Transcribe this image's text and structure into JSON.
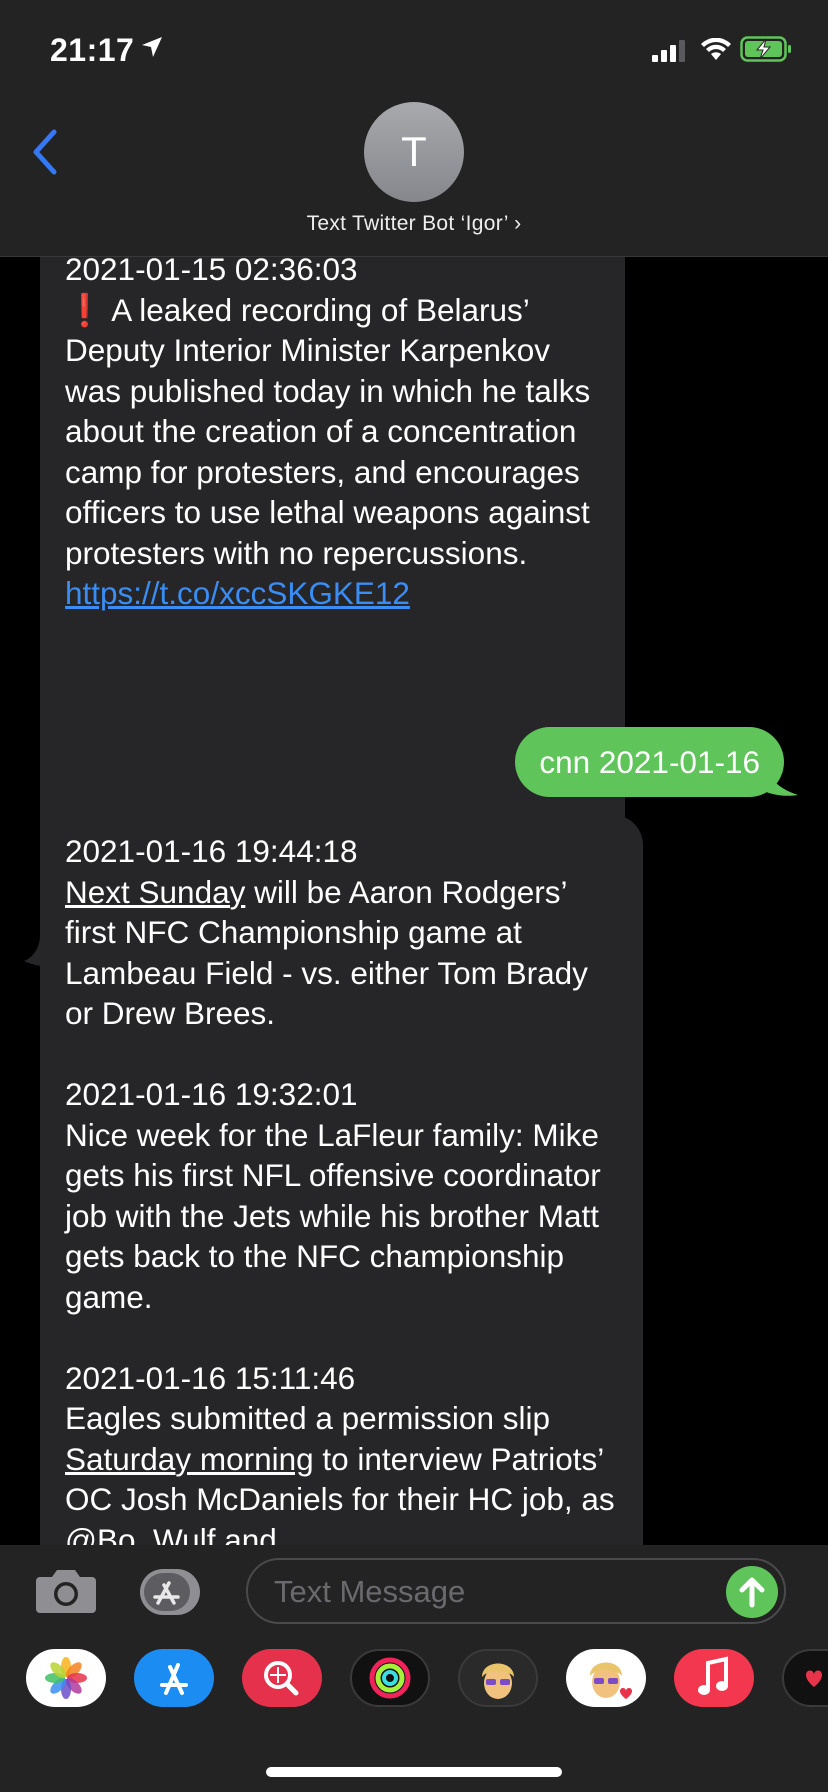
{
  "status_bar": {
    "time": "21:17"
  },
  "header": {
    "avatar_initial": "T",
    "contact_name": "Text Twitter Bot ‘Igor’ ›"
  },
  "messages": {
    "m1": {
      "timestamp": "2021-01-15 02:36:03",
      "emoji": "❗",
      "text": " A leaked recording of Belarus’ Deputy Interior Minister Karpenkov was published today in which he talks about the creation of a concentration camp for protesters, and encourages officers to use lethal weapons against protesters with no repercussions.  ",
      "link": "https://t.co/xccSKGKE12"
    },
    "m2": {
      "text": "cnn 2021-01-16"
    },
    "m3": {
      "t1": "2021-01-16 19:44:18",
      "u1": "Next Sunday",
      "p1": " will be Aaron Rodgers’ first NFC Championship game at Lambeau Field - vs. either Tom Brady or Drew Brees.",
      "t2": "2021-01-16 19:32:01",
      "p2": "Nice week for the LaFleur family: Mike gets his first NFL offensive coordinator job with the Jets while his brother Matt gets back to the NFC championship game.",
      "t3": "2021-01-16 15:11:46",
      "p3a": "Eagles submitted a permission slip ",
      "u3": "Saturday morning",
      "p3b": " to interview Patriots’ OC Josh McDaniels for their HC job, as @Bo_Wulf and"
    }
  },
  "input": {
    "placeholder": "Text Message"
  },
  "dock": {
    "apps": [
      "photos-icon",
      "app-store-icon",
      "web-images-icon",
      "activity-icon",
      "memoji-icon",
      "memoji-stickers-icon",
      "music-icon",
      "digital-touch-icon"
    ]
  },
  "colors": {
    "sent_bubble": "#5fc45a",
    "received_bubble": "#262628",
    "link": "#3a8df5",
    "accent": "#3478f6"
  }
}
